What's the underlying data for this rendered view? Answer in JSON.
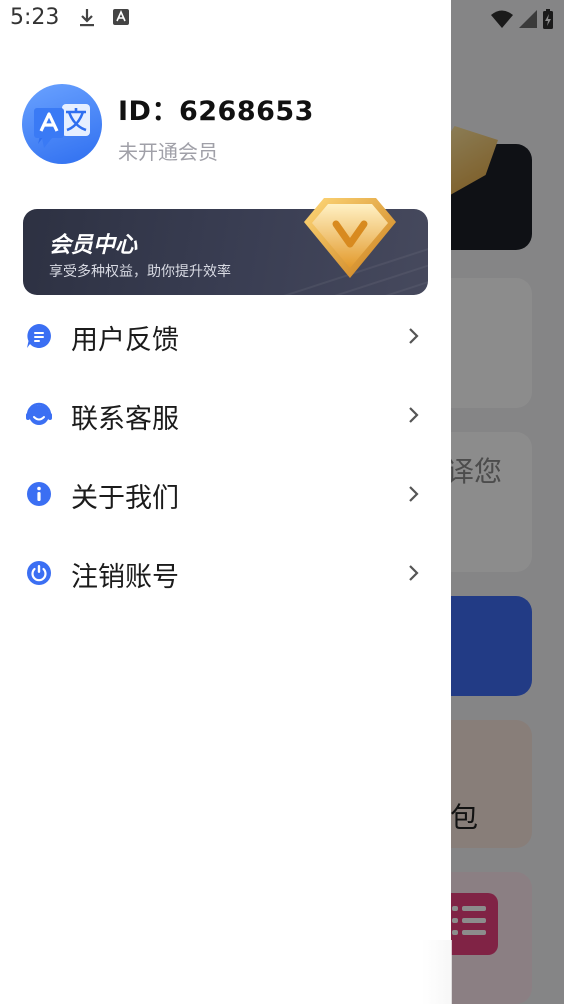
{
  "status_bar": {
    "time": "5:23"
  },
  "user": {
    "id_label": "ID：6268653",
    "membership": "未开通会员"
  },
  "vip": {
    "title": "会员中心",
    "subtitle": "享受多种权益，助你提升效率"
  },
  "menu": [
    {
      "label": "用户反馈",
      "icon": "feedback-icon"
    },
    {
      "label": "联系客服",
      "icon": "headset-icon"
    },
    {
      "label": "关于我们",
      "icon": "info-icon"
    },
    {
      "label": "注销账号",
      "icon": "power-icon"
    }
  ],
  "background_app": {
    "partial_text_1": "译您",
    "partial_text_2": "包"
  },
  "colors": {
    "accent": "#3b6ff3",
    "vip_bg": "#2d3142",
    "gold": "#f0b544"
  }
}
